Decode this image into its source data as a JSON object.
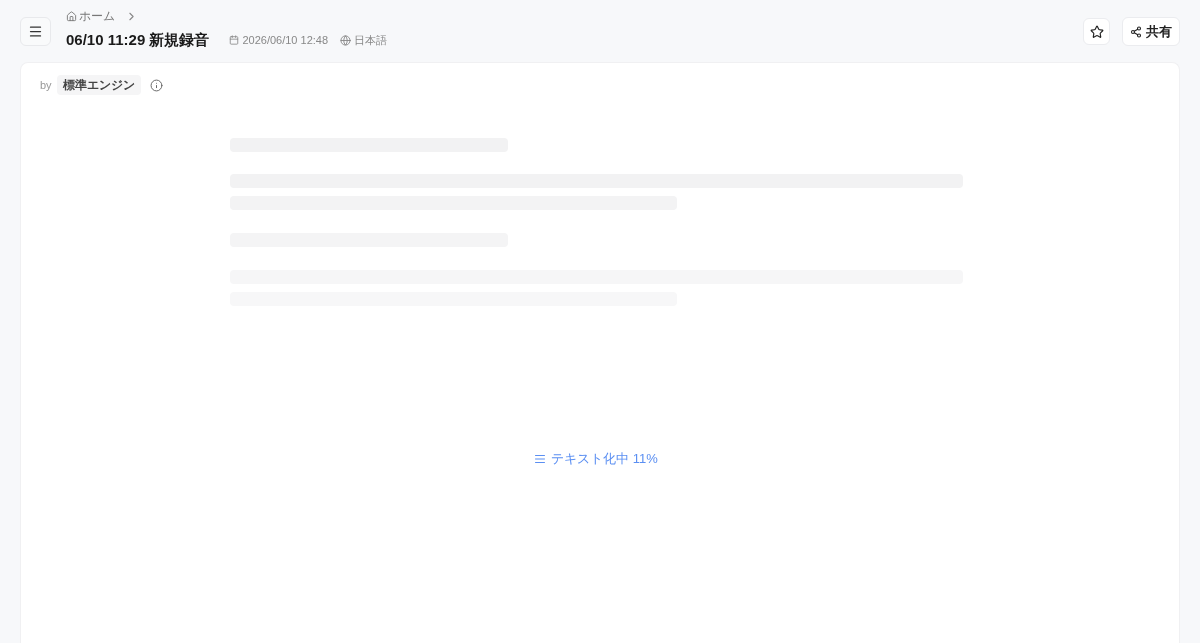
{
  "breadcrumb": [
    {
      "label": "ホーム"
    }
  ],
  "header": {
    "title": "06/10 11:29 新規録音",
    "date": "2026/06/10 12:48",
    "language": "日本語",
    "share_label": "共有"
  },
  "card": {
    "by_label": "by",
    "engine": "標準エンジン",
    "status": "テキスト化中 11%"
  }
}
